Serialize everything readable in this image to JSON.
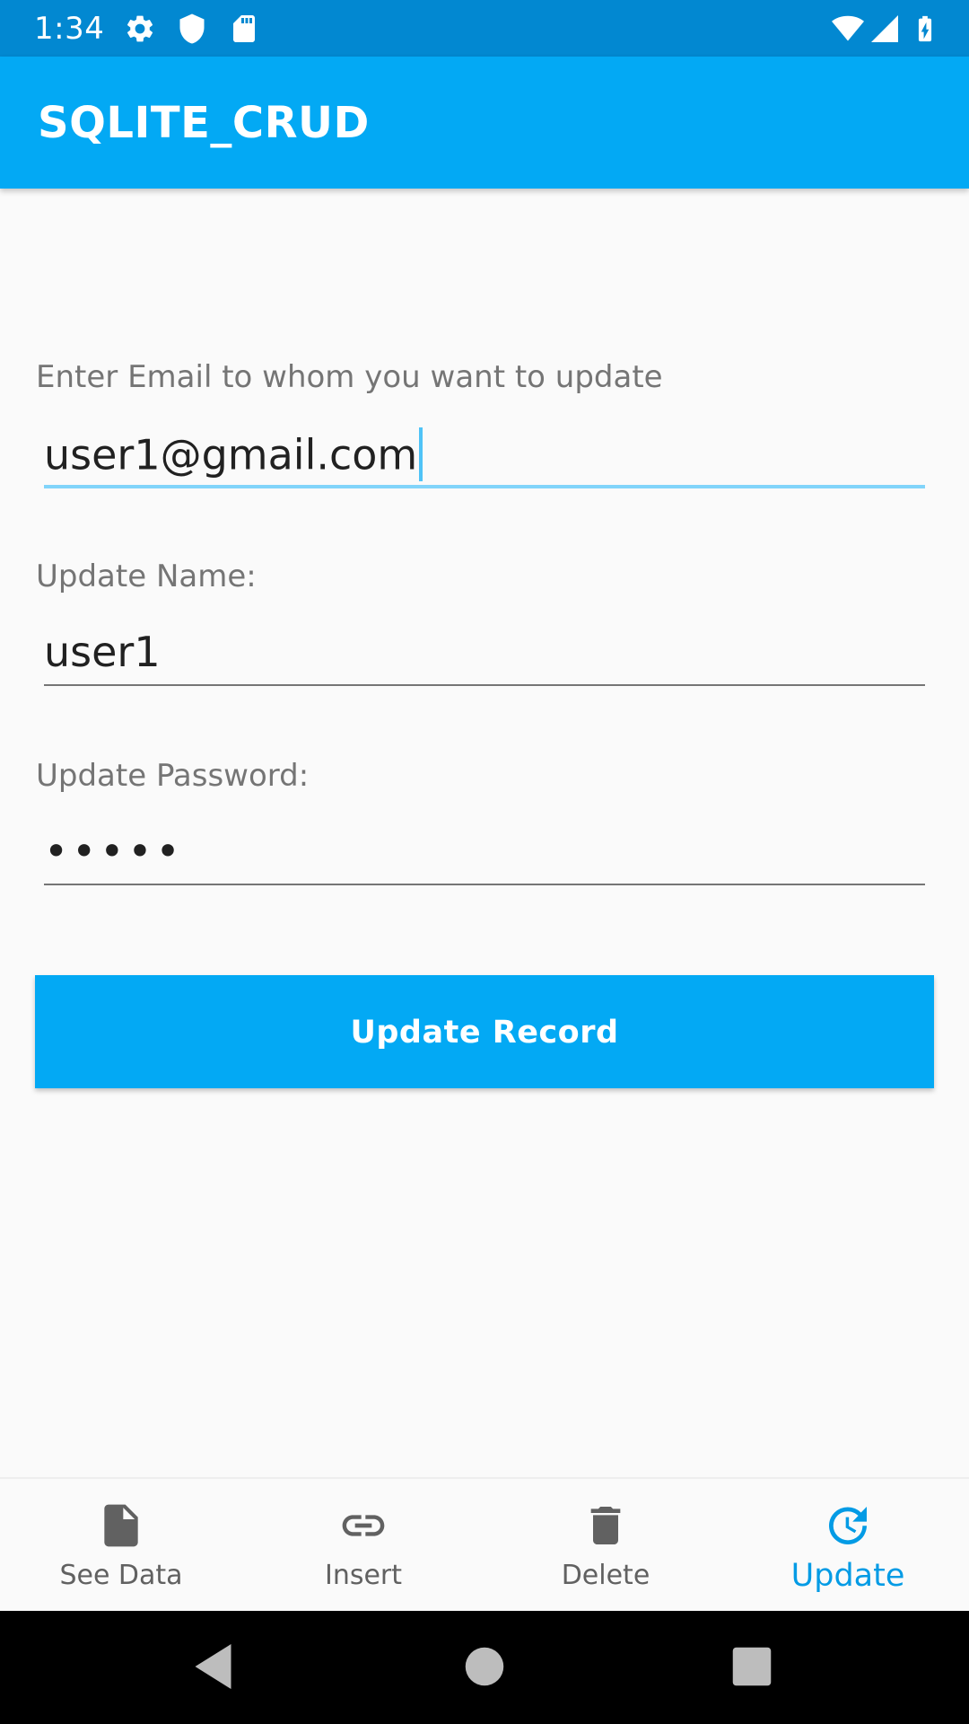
{
  "status_bar": {
    "time": "1:34",
    "left_icons": [
      "gear-icon",
      "shield-icon",
      "sd-card-icon"
    ],
    "right_icons": [
      "wifi-icon",
      "signal-icon",
      "battery-charging-icon"
    ]
  },
  "app_bar": {
    "title": "SQLITE_CRUD",
    "color": "#03A9F4"
  },
  "form": {
    "email": {
      "label": "Enter Email to whom you want to update",
      "value": "user1@gmail.com",
      "focused": true
    },
    "name": {
      "label": "Update Name:",
      "value": "user1"
    },
    "password": {
      "label": "Update Password:",
      "value": "•••••"
    },
    "submit_label": "Update Record"
  },
  "bottom_nav": {
    "items": [
      {
        "label": "See Data",
        "icon": "file-icon",
        "active": false
      },
      {
        "label": "Insert",
        "icon": "link-icon",
        "active": false
      },
      {
        "label": "Delete",
        "icon": "trash-icon",
        "active": false
      },
      {
        "label": "Update",
        "icon": "update-icon",
        "active": true
      }
    ],
    "active_color": "#039BE5"
  },
  "system_nav": {
    "buttons": [
      "back-icon",
      "home-icon",
      "recents-icon"
    ]
  }
}
